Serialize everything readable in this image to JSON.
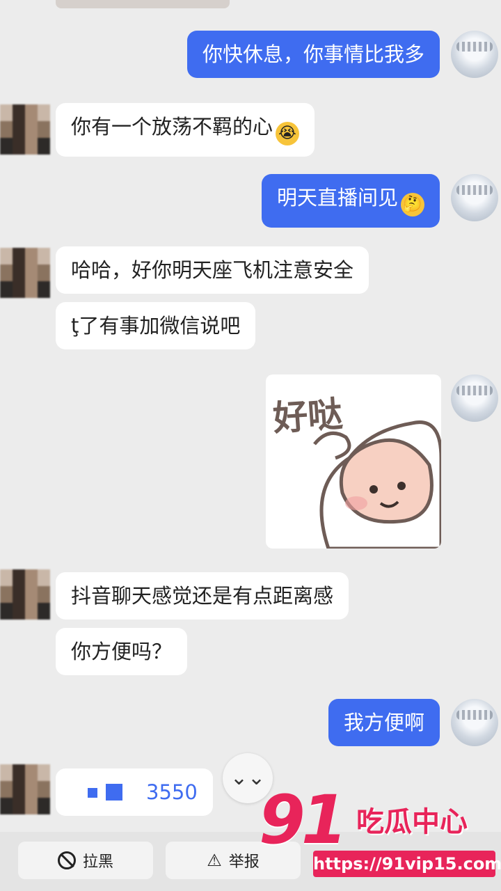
{
  "messages": {
    "m1": "你快休息，你事情比我多",
    "m2": "你有一个放荡不羁的心",
    "m2_emoji": "😭",
    "m3": "明天直播间见",
    "m3_emoji": "🤔",
    "m4": "哈哈，好你明天座飞机注意安全",
    "m5": "ţ了有事加微信说吧",
    "sticker_text": "好哒",
    "m6": "抖音聊天感觉还是有点距离感",
    "m7": "你方便吗？",
    "m8": "我方便啊",
    "m9": "3550"
  },
  "scroll_button": "⌄⌄",
  "bottom_bar": {
    "block_label": "拉黑",
    "report_label": "举报"
  },
  "watermark": {
    "number": "91",
    "name": "吃瓜中心",
    "url": "https://91vip15.com"
  },
  "icons": [
    "ban-icon",
    "warning-icon",
    "chevron-double-down-icon",
    "crying-emoji-icon",
    "thinking-emoji-icon"
  ]
}
